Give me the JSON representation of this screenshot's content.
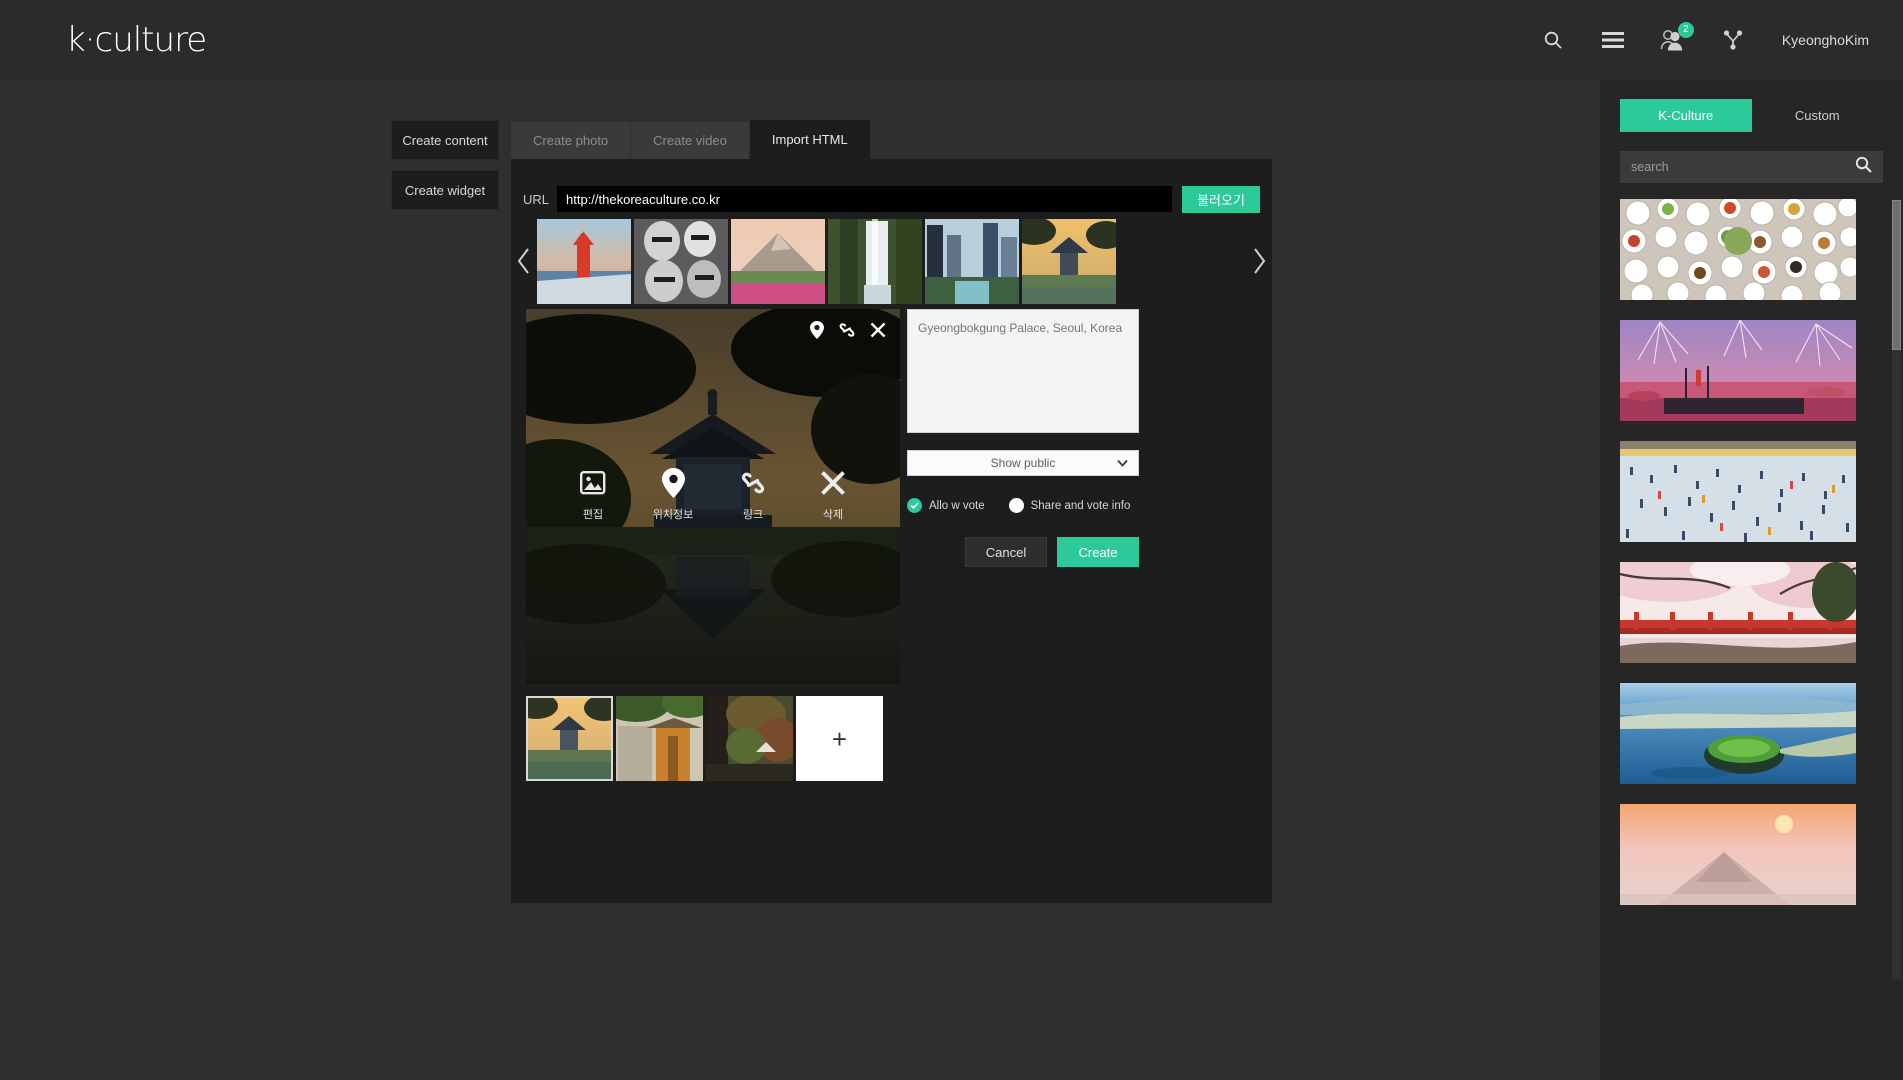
{
  "header": {
    "logo": "k·culture",
    "username": "KyeonghoKim",
    "notification_count": "2",
    "icons": [
      "search-icon",
      "menu-icon",
      "friends-icon",
      "share-network-icon"
    ]
  },
  "sidebar": {
    "buttons": [
      {
        "label": "Create content",
        "active": true
      },
      {
        "label": "Create widget",
        "active": false
      }
    ]
  },
  "tabs": [
    {
      "label": "Create photo",
      "active": false
    },
    {
      "label": "Create video",
      "active": false
    },
    {
      "label": "Import HTML",
      "active": true
    }
  ],
  "url_row": {
    "label": "URL",
    "value": "http://thekoreaculture.co.kr",
    "placeholder": "http://",
    "load_button": "불러오기"
  },
  "strip": {
    "prev_icon": "chevron-left-icon",
    "next_icon": "chevron-right-icon",
    "items": [
      {
        "alt": "Busan lighthouse at dusk"
      },
      {
        "alt": "Hahoe wooden masks"
      },
      {
        "alt": "Mountain with azalea field"
      },
      {
        "alt": "Waterfall in forest"
      },
      {
        "alt": "Cheonggyecheon city stream"
      },
      {
        "alt": "Hyangwonjeong pavilion"
      }
    ]
  },
  "preview": {
    "alt": "Hyangwonjeong pavilion at sunset reflected in pond",
    "corner_icons": [
      "location-pin-icon",
      "link-icon",
      "close-icon"
    ],
    "tools": [
      {
        "label": "편집",
        "icon": "image-edit-icon",
        "active": false
      },
      {
        "label": "위치정보",
        "icon": "location-pin-icon",
        "active": true
      },
      {
        "label": "링크",
        "icon": "link-icon",
        "active": false
      },
      {
        "label": "삭제",
        "icon": "close-icon",
        "active": false
      }
    ]
  },
  "form": {
    "description_value": "Gyeongbokgung Palace, Seoul, Korea",
    "description_placeholder": "Gyeongbokgung Palace, Seoul, Korea",
    "visibility_selected": "Show public",
    "visibility_icon": "chevron-down-icon",
    "checkboxes": [
      {
        "label": "Allo w vote",
        "checked": true
      },
      {
        "label": "Share and vote info",
        "checked": false
      }
    ],
    "cancel_label": "Cancel",
    "create_label": "Create"
  },
  "bottom_thumbs": {
    "items": [
      {
        "alt": "Hyangwonjeong pavilion",
        "selected": true
      },
      {
        "alt": "Hanok gate with wooden door",
        "selected": false
      },
      {
        "alt": "Autumn temple path",
        "selected": false
      }
    ],
    "add_label": "+"
  },
  "gallery": {
    "tabs": [
      {
        "label": "K-Culture",
        "active": true
      },
      {
        "label": "Custom",
        "active": false
      }
    ],
    "search_placeholder": "search",
    "search_value": "",
    "search_icon": "search-icon",
    "items": [
      {
        "alt": "Korean royal banquet table of side dishes"
      },
      {
        "alt": "Fireworks festival over harbor with ships"
      },
      {
        "alt": "Ice fishing festival crowd on frozen river"
      },
      {
        "alt": "Cherry blossoms over red bridge"
      },
      {
        "alt": "Seongsan Ilchulbong crater Jeju island"
      },
      {
        "alt": "Mountain sunrise in pink mist"
      }
    ]
  },
  "colors": {
    "accent": "#2cc99b",
    "header_bg": "#2b2b2b",
    "page_bg": "#2f2f2f",
    "panel_bg": "#1d1d1d",
    "gallery_bg": "#262626"
  }
}
